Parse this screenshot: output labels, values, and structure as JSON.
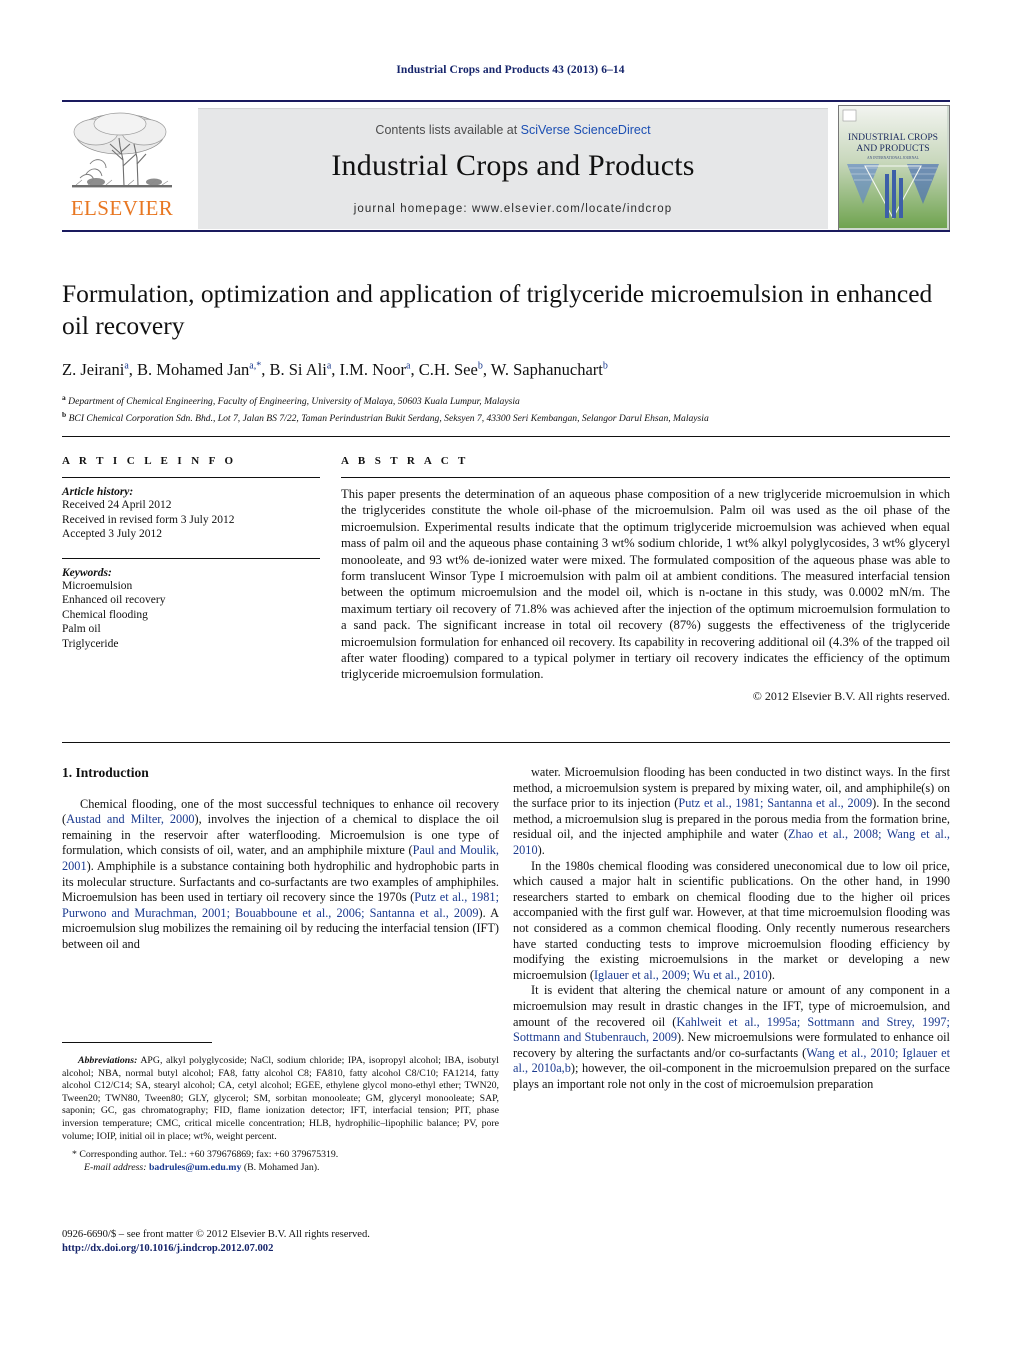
{
  "running_head": "Industrial Crops and Products 43 (2013) 6–14",
  "masthead": {
    "contents_prefix": "Contents lists available at ",
    "sciencedirect_link": "SciVerse ScienceDirect",
    "journal_title": "Industrial Crops and Products",
    "homepage_prefix": "journal homepage: ",
    "homepage_url": "www.elsevier.com/locate/indcrop",
    "publisher_wordmark": "ELSEVIER",
    "cover_title_line1": "INDUSTRIAL CROPS",
    "cover_title_line2": "AND PRODUCTS",
    "colors": {
      "rule": "#1a1a5e",
      "band_background": "#e6e7e8",
      "link": "#1c4fb3",
      "elsevier_orange": "#E87722",
      "cover_green": "#7fae56"
    }
  },
  "article": {
    "title": "Formulation, optimization and application of triglyceride microemulsion in enhanced oil recovery",
    "authors_html": "Z. Jeirani<sup>a</sup>, B. Mohamed Jan<sup>a,*</sup>, B. Si Ali<sup>a</sup>, I.M. Noor<sup>a</sup>, C.H. See<sup>b</sup>, W. Saphanuchart<sup>b</sup>",
    "affiliations": [
      {
        "marker": "a",
        "text": "Department of Chemical Engineering, Faculty of Engineering, University of Malaya, 50603 Kuala Lumpur, Malaysia"
      },
      {
        "marker": "b",
        "text": "BCI Chemical Corporation Sdn. Bhd., Lot 7, Jalan BS 7/22, Taman Perindustrian Bukit Serdang, Seksyen 7, 43300 Seri Kembangan, Selangor Darul Ehsan, Malaysia"
      }
    ]
  },
  "article_info": {
    "heading": "A R T I C L E    I N F O",
    "history_label": "Article history:",
    "history": [
      "Received 24 April 2012",
      "Received in revised form 3 July 2012",
      "Accepted 3 July 2012"
    ],
    "keywords_label": "Keywords:",
    "keywords": [
      "Microemulsion",
      "Enhanced oil recovery",
      "Chemical flooding",
      "Palm oil",
      "Triglyceride"
    ]
  },
  "abstract": {
    "heading": "A B S T R A C T",
    "text": "This paper presents the determination of an aqueous phase composition of a new triglyceride microemulsion in which the triglycerides constitute the whole oil-phase of the microemulsion. Palm oil was used as the oil phase of the microemulsion. Experimental results indicate that the optimum triglyceride microemulsion was achieved when equal mass of palm oil and the aqueous phase containing 3 wt% sodium chloride, 1 wt% alkyl polyglycosides, 3 wt% glyceryl monooleate, and 93 wt% de-ionized water were mixed. The formulated composition of the aqueous phase was able to form translucent Winsor Type I microemulsion with palm oil at ambient conditions. The measured interfacial tension between the optimum microemulsion and the model oil, which is n-octane in this study, was 0.0002 mN/m. The maximum tertiary oil recovery of 71.8% was achieved after the injection of the optimum microemulsion formulation to a sand pack. The significant increase in total oil recovery (87%) suggests the effectiveness of the triglyceride microemulsion formulation for enhanced oil recovery. Its capability in recovering additional oil (4.3% of the trapped oil after water flooding) compared to a typical polymer in tertiary oil recovery indicates the efficiency of the optimum triglyceride microemulsion formulation.",
    "copyright": "© 2012 Elsevier B.V. All rights reserved."
  },
  "body": {
    "section_heading": "1.  Introduction",
    "left_paragraphs": [
      {
        "parts": [
          {
            "t": "Chemical flooding, one of the most successful techniques to enhance oil recovery (",
            "cite": false
          },
          {
            "t": "Austad and Milter, 2000",
            "cite": true
          },
          {
            "t": "), involves the injection of a chemical to displace the oil remaining in the reservoir after waterflooding. Microemulsion is one type of formulation, which consists of oil, water, and an amphiphile mixture (",
            "cite": false
          },
          {
            "t": "Paul and Moulik, 2001",
            "cite": true
          },
          {
            "t": "). Amphiphile is a substance containing both hydrophilic and hydrophobic parts in its molecular structure. Surfactants and co-surfactants are two examples of amphiphiles. Microemulsion has been used in tertiary oil recovery since the 1970s (",
            "cite": false
          },
          {
            "t": "Putz et al., 1981; Purwono and Murachman, 2001; Bouabboune et al., 2006; Santanna et al., 2009",
            "cite": true
          },
          {
            "t": "). A microemulsion slug mobilizes the remaining oil by reducing the interfacial tension (IFT) between oil and",
            "cite": false
          }
        ]
      }
    ],
    "right_paragraphs": [
      {
        "parts": [
          {
            "t": "water. Microemulsion flooding has been conducted in two distinct ways. In the first method, a microemulsion system is prepared by mixing water, oil, and amphiphile(s) on the surface prior to its injection (",
            "cite": false
          },
          {
            "t": "Putz et al., 1981; Santanna et al., 2009",
            "cite": true
          },
          {
            "t": "). In the second method, a microemulsion slug is prepared in the porous media from the formation brine, residual oil, and the injected amphiphile and water (",
            "cite": false
          },
          {
            "t": "Zhao et al., 2008; Wang et al., 2010",
            "cite": true
          },
          {
            "t": ").",
            "cite": false
          }
        ]
      },
      {
        "parts": [
          {
            "t": "In the 1980s chemical flooding was considered uneconomical due to low oil price, which caused a major halt in scientific publications. On the other hand, in 1990 researchers started to embark on chemical flooding due to the higher oil prices accompanied with the first gulf war. However, at that time microemulsion flooding was not considered as a common chemical flooding. Only recently numerous researchers have started conducting tests to improve microemulsion flooding efficiency by modifying the existing microemulsions in the market or developing a new microemulsion (",
            "cite": false
          },
          {
            "t": "Iglauer et al., 2009; Wu et al., 2010",
            "cite": true
          },
          {
            "t": ").",
            "cite": false
          }
        ]
      },
      {
        "parts": [
          {
            "t": "It is evident that altering the chemical nature or amount of any component in a microemulsion may result in drastic changes in the IFT, type of microemulsion, and amount of the recovered oil (",
            "cite": false
          },
          {
            "t": "Kahlweit et al., 1995a; Sottmann and Strey, 1997; Sottmann and Stubenrauch, 2009",
            "cite": true
          },
          {
            "t": "). New microemulsions were formulated to enhance oil recovery by altering the surfactants and/or co-surfactants (",
            "cite": false
          },
          {
            "t": "Wang et al., 2010; Iglauer et al., 2010a,b",
            "cite": true
          },
          {
            "t": "); however, the oil-component in the microemulsion prepared on the surface plays an important role not only in the cost of microemulsion preparation",
            "cite": false
          }
        ]
      }
    ]
  },
  "footnotes": {
    "abbreviations_label": "Abbreviations:",
    "abbreviations_text": "APG, alkyl polyglycoside; NaCl, sodium chloride; IPA, isopropyl alcohol; IBA, isobutyl alcohol; NBA, normal butyl alcohol; FA8, fatty alcohol C8; FA810, fatty alcohol C8/C10; FA1214, fatty alcohol C12/C14; SA, stearyl alcohol; CA, cetyl alcohol; EGEE, ethylene glycol mono-ethyl ether; TWN20, Tween20; TWN80, Tween80; GLY, glycerol; SM, sorbitan monooleate; GM, glyceryl monooleate; SAP, saponin; GC, gas chromatography; FID, flame ionization detector; IFT, interfacial tension; PIT, phase inversion temperature; CMC, critical micelle concentration; HLB, hydrophilic–lipophilic balance; PV, pore volume; IOIP, initial oil in place; wt%, weight percent.",
    "corresponding": "* Corresponding author. Tel.: +60 379676869; fax: +60 379675319.",
    "email_label": "E-mail address:",
    "email_address": "badrules@um.edu.my",
    "email_owner": "(B. Mohamed Jan).",
    "issn_line": "0926-6690/$ – see front matter © 2012 Elsevier B.V. All rights reserved.",
    "doi_line": "http://dx.doi.org/10.1016/j.indcrop.2012.07.002"
  }
}
